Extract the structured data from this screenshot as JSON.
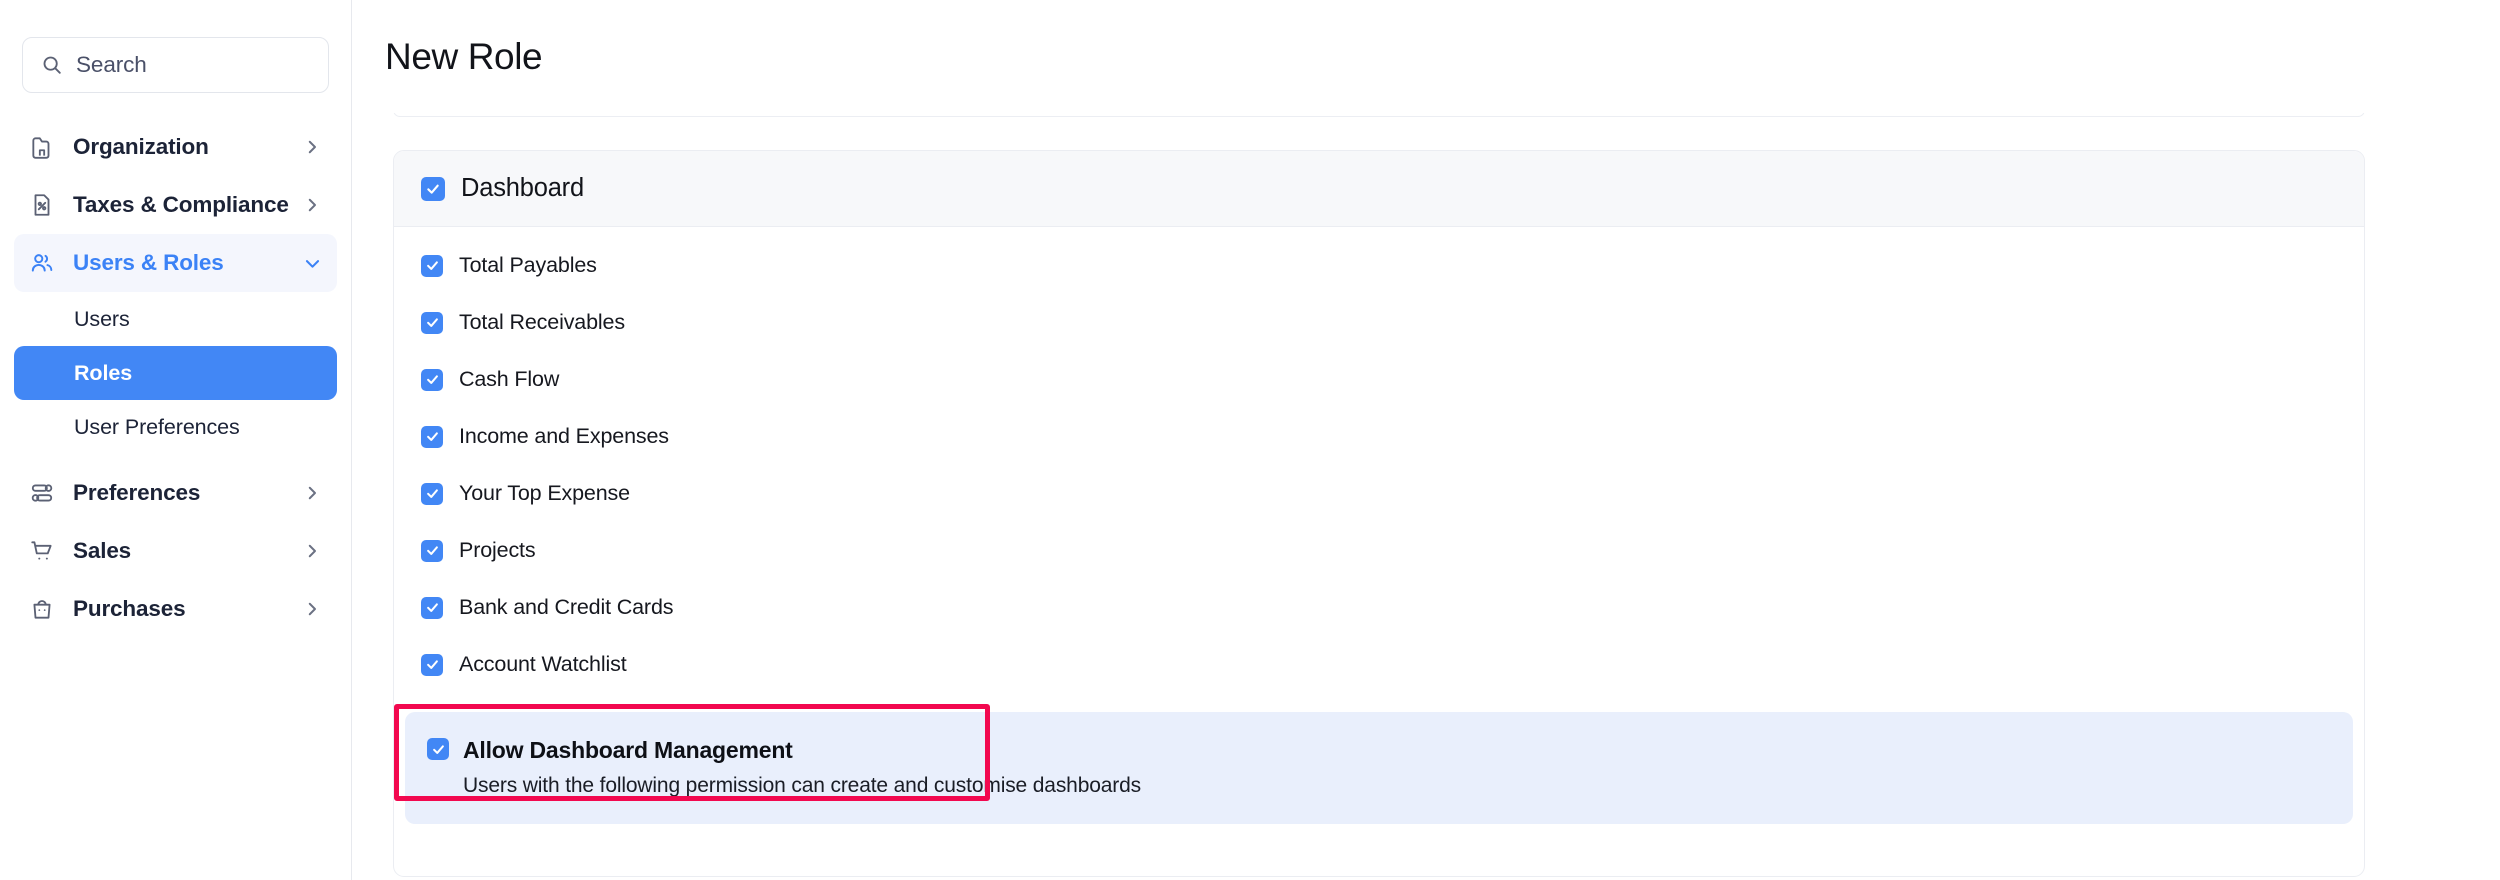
{
  "sidebar": {
    "search": {
      "placeholder": "Search",
      "value": "",
      "icon": "search-icon"
    },
    "items": [
      {
        "label": "Organization",
        "icon": "organization-icon",
        "chevron": "chevron-right-icon",
        "state": "collapsed"
      },
      {
        "label": "Taxes & Compliance",
        "icon": "taxes-compliance-icon",
        "chevron": "chevron-right-icon",
        "state": "collapsed"
      },
      {
        "label": "Users & Roles",
        "icon": "users-roles-icon",
        "chevron": "chevron-down-icon",
        "state": "expanded",
        "active": true
      },
      {
        "label": "Preferences",
        "icon": "preferences-icon",
        "chevron": "chevron-right-icon",
        "state": "collapsed"
      },
      {
        "label": "Sales",
        "icon": "sales-cart-icon",
        "chevron": "chevron-right-icon",
        "state": "collapsed"
      },
      {
        "label": "Purchases",
        "icon": "purchases-bag-icon",
        "chevron": "chevron-right-icon",
        "state": "collapsed"
      }
    ],
    "sub_items": [
      {
        "label": "Users",
        "selected": false
      },
      {
        "label": "Roles",
        "selected": true
      },
      {
        "label": "User Preferences",
        "selected": false
      }
    ]
  },
  "header": {
    "title": "New Role"
  },
  "permission_card": {
    "group": {
      "label": "Dashboard",
      "checked": true
    },
    "items": [
      {
        "label": "Total Payables",
        "checked": true
      },
      {
        "label": "Total Receivables",
        "checked": true
      },
      {
        "label": "Cash Flow",
        "checked": true
      },
      {
        "label": "Income and Expenses",
        "checked": true
      },
      {
        "label": "Your Top Expense",
        "checked": true
      },
      {
        "label": "Projects",
        "checked": true
      },
      {
        "label": "Bank and Credit Cards",
        "checked": true
      },
      {
        "label": "Account Watchlist",
        "checked": true
      }
    ],
    "highlighted_permission": {
      "title": "Allow Dashboard Management",
      "description": "Users with the following permission can create and customise dashboards",
      "checked": true,
      "annotated": true
    }
  },
  "colors": {
    "accent_blue": "#4287f5",
    "active_nav_text": "#3b82f6",
    "active_nav_bg": "#f4f6fd",
    "selected_sub_bg": "#4287f5",
    "card_header_bg": "#f7f8fa",
    "highlight_band_bg": "#e9effc",
    "annotation_border": "#f2084f",
    "border_grey": "#ebedf2",
    "text_primary": "#12141a",
    "text_muted": "#4a5068"
  }
}
